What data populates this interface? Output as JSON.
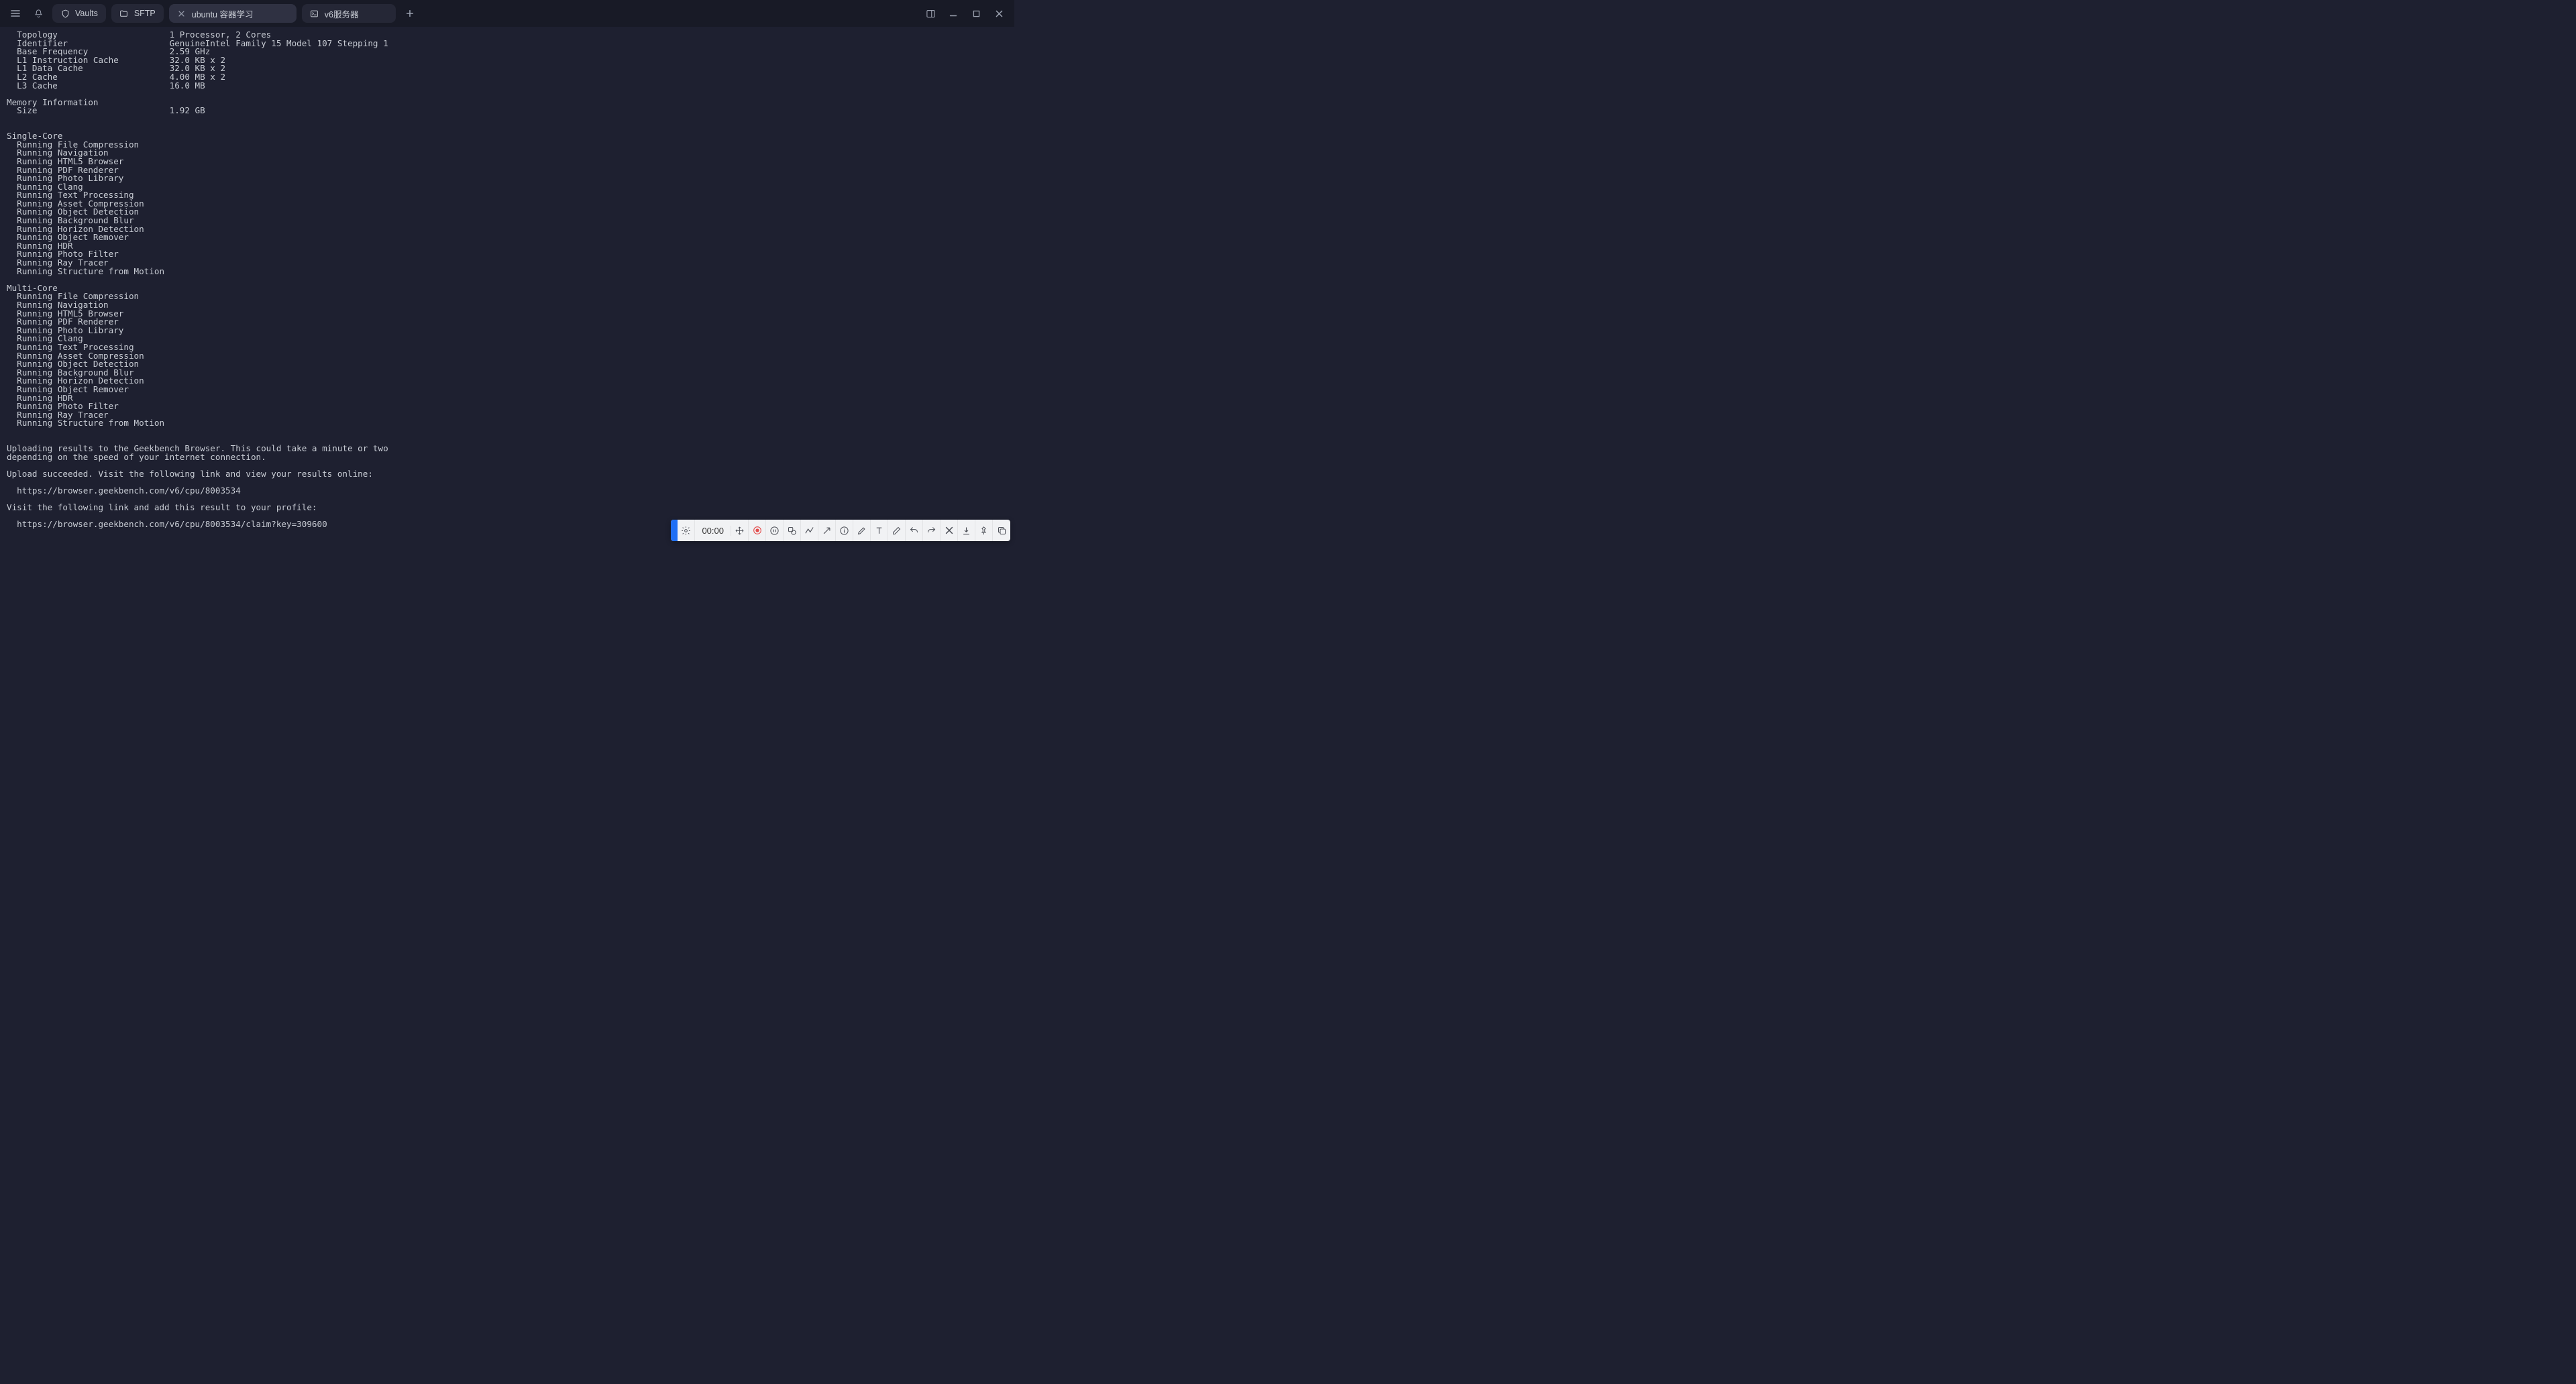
{
  "tabbar": {
    "tabs": [
      {
        "icon": "shield-icon",
        "label": "Vaults",
        "active": false,
        "closable": false
      },
      {
        "icon": "folder-icon",
        "label": "SFTP",
        "active": false,
        "closable": false
      },
      {
        "icon": "close-icon",
        "label": "ubuntu 容器学习",
        "active": true,
        "closable": true
      },
      {
        "icon": "terminal-icon",
        "label": "v6服务器",
        "active": false,
        "closable": false
      }
    ]
  },
  "system_info": {
    "rows": [
      {
        "k": "Topology",
        "v": "1 Processor, 2 Cores"
      },
      {
        "k": "Identifier",
        "v": "GenuineIntel Family 15 Model 107 Stepping 1"
      },
      {
        "k": "Base Frequency",
        "v": "2.59 GHz"
      },
      {
        "k": "L1 Instruction Cache",
        "v": "32.0 KB x 2"
      },
      {
        "k": "L1 Data Cache",
        "v": "32.0 KB x 2"
      },
      {
        "k": "L2 Cache",
        "v": "4.00 MB x 2"
      },
      {
        "k": "L3 Cache",
        "v": "16.0 MB"
      }
    ]
  },
  "memory_header": "Memory Information",
  "memory": {
    "rows": [
      {
        "k": "Size",
        "v": "1.92 GB"
      }
    ]
  },
  "single_core_header": "Single-Core",
  "multi_core_header": "Multi-Core",
  "benchmarks": [
    "Running File Compression",
    "Running Navigation",
    "Running HTML5 Browser",
    "Running PDF Renderer",
    "Running Photo Library",
    "Running Clang",
    "Running Text Processing",
    "Running Asset Compression",
    "Running Object Detection",
    "Running Background Blur",
    "Running Horizon Detection",
    "Running Object Remover",
    "Running HDR",
    "Running Photo Filter",
    "Running Ray Tracer",
    "Running Structure from Motion"
  ],
  "upload_msg_l1": "Uploading results to the Geekbench Browser. This could take a minute or two",
  "upload_msg_l2": "depending on the speed of your internet connection.",
  "upload_success": "Upload succeeded. Visit the following link and view your results online:",
  "result_url": "https://browser.geekbench.com/v6/cpu/8003534",
  "claim_prompt": "Visit the following link and add this result to your profile:",
  "claim_url": "https://browser.geekbench.com/v6/cpu/8003534/claim?key=309600",
  "rec": {
    "time": "00:00"
  }
}
